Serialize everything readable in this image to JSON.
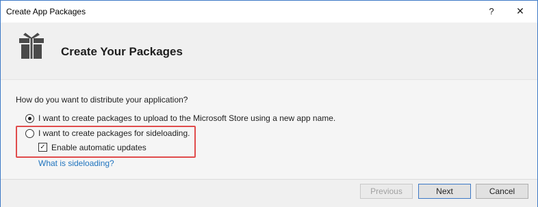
{
  "window": {
    "title": "Create App Packages",
    "help_label": "?",
    "close_label": "✕"
  },
  "header": {
    "title": "Create Your Packages",
    "icon": "gift-icon"
  },
  "content": {
    "question": "How do you want to distribute your application?",
    "options": [
      {
        "label": "I want to create packages to upload to the Microsoft Store using a new app name.",
        "selected": true
      },
      {
        "label": "I want to create packages for sideloading.",
        "selected": false
      }
    ],
    "auto_update": {
      "label": "Enable automatic updates",
      "checked": true
    },
    "link_text": "What is sideloading?"
  },
  "footer": {
    "previous_label": "Previous",
    "next_label": "Next",
    "cancel_label": "Cancel"
  },
  "colors": {
    "highlight": "#e04b4b",
    "link": "#1e73be",
    "accent": "#3c78c6"
  }
}
